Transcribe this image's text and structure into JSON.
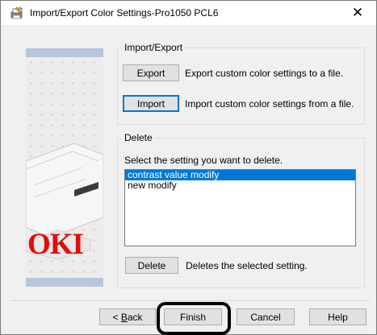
{
  "window": {
    "title": "Import/Export Color Settings-Pro1050 PCL6",
    "close_glyph": "✕"
  },
  "banner": {
    "logo_text": "OKI",
    "logo_color": "#e30c0c",
    "band_color": "#b7c6dd"
  },
  "import_export": {
    "group_label": "Import/Export",
    "export_button": "Export",
    "export_description": "Export custom color settings to a file.",
    "import_button": "Import",
    "import_description": "Import custom color settings from a file."
  },
  "delete_section": {
    "group_label": "Delete",
    "instruction": "Select the setting you want to delete.",
    "items": [
      {
        "label": "contrast value modify",
        "selected": true
      },
      {
        "label": "new modify",
        "selected": false
      }
    ],
    "delete_button": "Delete",
    "delete_description": "Deletes the selected setting."
  },
  "footer": {
    "back_prefix": "< ",
    "back_access_key": "B",
    "back_rest": "ack",
    "finish": "Finish",
    "cancel": "Cancel",
    "help": "Help"
  },
  "colors": {
    "accent": "#0078d7",
    "dialog_bg": "#f0f0f0"
  }
}
